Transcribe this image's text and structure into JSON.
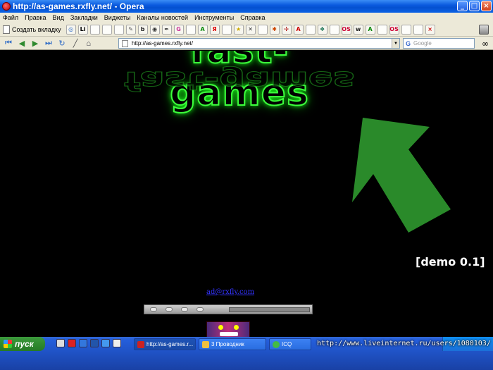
{
  "window": {
    "title": "http://as-games.rxfly.net/ - Opera",
    "controls": {
      "minimize": "_",
      "maximize": "□",
      "close": "×"
    }
  },
  "menu": {
    "items": [
      "Файл",
      "Правка",
      "Вид",
      "Закладки",
      "Виджеты",
      "Каналы новостей",
      "Инструменты",
      "Справка"
    ]
  },
  "toolbar": {
    "new_tab_label": "Создать вкладку",
    "bookmarks": [
      {
        "icon": "bookmark-opera-icon",
        "glyph": "◎",
        "color": "#2e6bc6"
      },
      {
        "icon": "bookmark-li-icon",
        "glyph": "Li",
        "color": "#000000"
      },
      {
        "icon": "bookmark-page-icon",
        "glyph": "",
        "color": "#888888"
      },
      {
        "icon": "bookmark-page-icon",
        "glyph": "",
        "color": "#888888"
      },
      {
        "icon": "bookmark-page-icon",
        "glyph": "",
        "color": "#888888"
      },
      {
        "icon": "bookmark-tools-icon",
        "glyph": "✎",
        "color": "#555555"
      },
      {
        "icon": "bookmark-b-icon",
        "glyph": "b",
        "color": "#222222"
      },
      {
        "icon": "bookmark-camera-icon",
        "glyph": "◉",
        "color": "#333333"
      },
      {
        "icon": "bookmark-pen-icon",
        "glyph": "✒",
        "color": "#333333"
      },
      {
        "icon": "bookmark-g-icon",
        "glyph": "G",
        "color": "#cc3399"
      },
      {
        "icon": "bookmark-page-icon",
        "glyph": "",
        "color": "#888888"
      },
      {
        "icon": "bookmark-a-icon",
        "glyph": "A",
        "color": "#0a8a0a"
      },
      {
        "icon": "bookmark-yandex-icon",
        "glyph": "Я",
        "color": "#dd0000"
      },
      {
        "icon": "bookmark-page-icon",
        "glyph": "",
        "color": "#888888"
      },
      {
        "icon": "bookmark-star-icon",
        "glyph": "★",
        "color": "#ccaa00"
      },
      {
        "icon": "bookmark-x-icon",
        "glyph": "✕",
        "color": "#333333"
      },
      {
        "icon": "bookmark-page-icon",
        "glyph": "",
        "color": "#888888"
      },
      {
        "icon": "bookmark-bug-icon",
        "glyph": "✱",
        "color": "#cc4400"
      },
      {
        "icon": "bookmark-cross-icon",
        "glyph": "✢",
        "color": "#aa0000"
      },
      {
        "icon": "bookmark-pdf-icon",
        "glyph": "A",
        "color": "#cc0000"
      },
      {
        "icon": "bookmark-page-icon",
        "glyph": "",
        "color": "#888888"
      },
      {
        "icon": "bookmark-leaf-icon",
        "glyph": "❖",
        "color": "#0a6a4a"
      },
      {
        "icon": "bookmark-page-icon",
        "glyph": "",
        "color": "#888888"
      },
      {
        "icon": "bookmark-os-icon",
        "glyph": "OS",
        "color": "#cc0033"
      },
      {
        "icon": "bookmark-web-icon",
        "glyph": "w",
        "color": "#222222"
      },
      {
        "icon": "bookmark-a-icon",
        "glyph": "A",
        "color": "#0a8a0a"
      },
      {
        "icon": "bookmark-page-icon",
        "glyph": "",
        "color": "#888888"
      },
      {
        "icon": "bookmark-os-icon",
        "glyph": "OS",
        "color": "#cc0033"
      },
      {
        "icon": "bookmark-page-icon",
        "glyph": "",
        "color": "#888888"
      },
      {
        "icon": "bookmark-page-icon",
        "glyph": "",
        "color": "#888888"
      },
      {
        "icon": "bookmark-close-icon",
        "glyph": "×",
        "color": "#cc0000"
      }
    ]
  },
  "address": {
    "url": "http://as-games.rxfly.net/",
    "search_placeholder": "Google",
    "search_engine_glyph": "G"
  },
  "content": {
    "logo_text": "fast-games",
    "demo_label": "[demo 0.1]",
    "email_link": "ad@rxfly.com",
    "accent_green": "#2a8a2a",
    "background": "#000000"
  },
  "taskbar": {
    "start_label": "пуск",
    "tasks": [
      {
        "label": "http://as-games.r...",
        "icon_color": "#cc2222",
        "active": true
      },
      {
        "label": "3 Проводник",
        "icon_color": "#f0c040",
        "active": false
      },
      {
        "label": "ICQ",
        "icon_color": "#44bb44",
        "active": false
      }
    ],
    "watermark": "http://www.liveinternet.ru/users/1080103/"
  }
}
